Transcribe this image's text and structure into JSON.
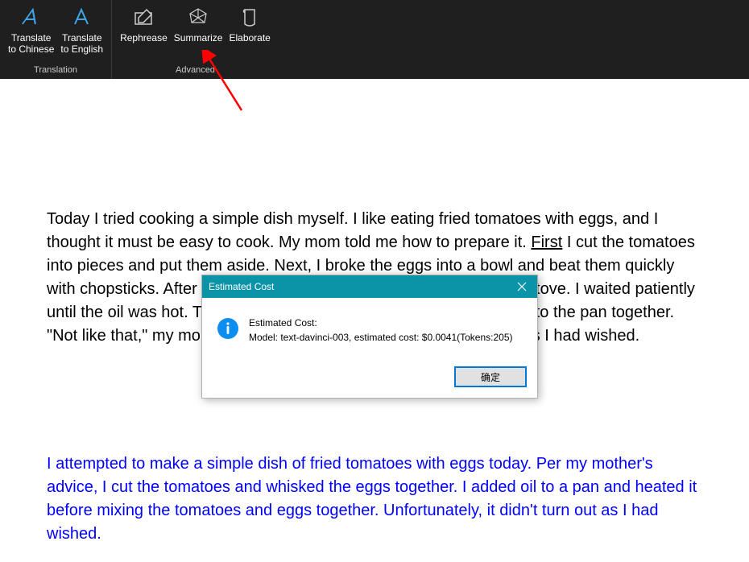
{
  "ribbon": {
    "groups": [
      {
        "label": "Translation",
        "buttons": [
          {
            "label": "Translate\nto Chinese"
          },
          {
            "label": "Translate\nto English"
          }
        ]
      },
      {
        "label": "Advanced",
        "buttons": [
          {
            "label": "Rephrease"
          },
          {
            "label": "Summarize"
          },
          {
            "label": "Elaborate"
          }
        ]
      }
    ]
  },
  "document": {
    "p1_a": "Today I tried cooking a simple dish myself. I like eating fried tomatoes with eggs, and I thought it must be easy to cook. My mom told me how to prepare it. ",
    "p1_first": "First",
    "p1_b": " I cut the tomatoes into pieces and put them aside. Next, I broke the eggs into a bowl and beat them quickly with chopsticks. After that, I poured oil into a pan and turned on the stove. I waited patiently until the oil was hot. Then, I put the tomatoes and the beaten eggs into the pan together. \"Not like that,\" my mom tried to stop me but failed. It didn't turn out as I had wished.",
    "p2": "I attempted to make a simple dish of fried tomatoes with eggs today. Per my mother's advice, I cut the tomatoes and whisked the eggs together. I added oil to a pan and heated it before mixing the tomatoes and eggs together. Unfortunately, it didn't turn out as I had wished."
  },
  "dialog": {
    "title": "Estimated Cost",
    "line1": "Estimated Cost:",
    "line2": "Model: text-davinci-003, estimated cost: $0.0041(Tokens:205)",
    "ok": "确定"
  }
}
